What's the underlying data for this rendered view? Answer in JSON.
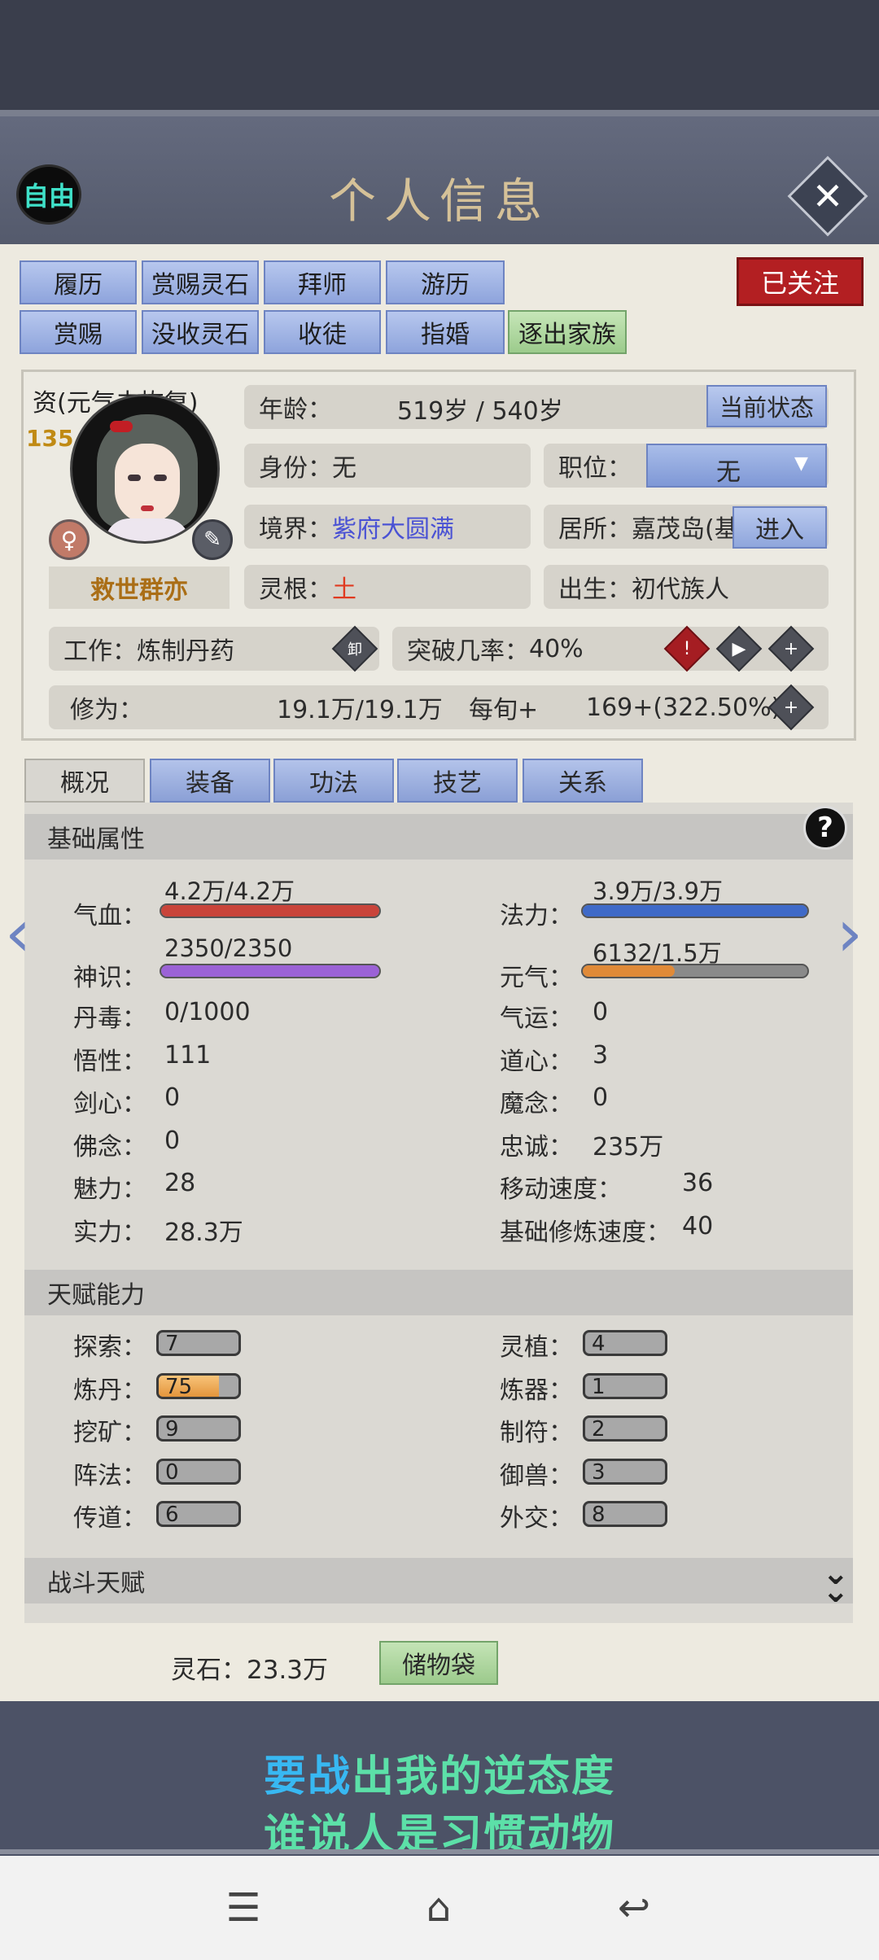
{
  "header": {
    "free_label": "自由",
    "title": "个人信息",
    "close_icon": "close-icon"
  },
  "actions": {
    "row1": [
      "履历",
      "赏赐灵石",
      "拜师",
      "游历"
    ],
    "row2": [
      "赏赐",
      "没收灵石",
      "收徒",
      "指婚",
      "逐出家族"
    ],
    "follow": "已关注"
  },
  "profile": {
    "aptitude_label": "资(元气未恢复)",
    "aptitude_value": "135",
    "name": "救世群亦",
    "gender_icon": "female-icon",
    "age_label": "年龄：",
    "age_value": "519岁 / 540岁",
    "state_button": "当前状态",
    "identity_label": "身份：",
    "identity_value": "无",
    "position_label": "职位：",
    "position_value": "无",
    "realm_label": "境界：",
    "realm_value": "紫府大圆满",
    "residence_label": "居所：嘉茂岛(基",
    "enter_button": "进入",
    "root_label": "灵根：",
    "root_value": "土",
    "birth_label": "出生：",
    "birth_value": "初代族人",
    "work_label": "工作：炼制丹药",
    "unload_label": "卸",
    "breakthrough_label": "突破几率：",
    "breakthrough_value": "40%",
    "cultivation_label": "修为：",
    "cultivation_value": "19.1万/19.1万",
    "per_round_label": "每旬+",
    "per_round_value": "169+(322.50%)"
  },
  "tabs": [
    "概况",
    "装备",
    "功法",
    "技艺",
    "关系"
  ],
  "sections": {
    "basic": "基础属性",
    "talent": "天赋能力",
    "combat": "战斗天赋"
  },
  "bars": {
    "hp": {
      "label": "气血：",
      "text": "4.2万/4.2万",
      "fraction": 1.0,
      "color": "#c9443a"
    },
    "mana": {
      "label": "法力：",
      "text": "3.9万/3.9万",
      "fraction": 1.0,
      "color": "#3f6ac8"
    },
    "spirit": {
      "label": "神识：",
      "text": "2350/2350",
      "fraction": 1.0,
      "color": "#9b62d6"
    },
    "vitality": {
      "label": "元气：",
      "text": "6132/1.5万",
      "fraction": 0.41,
      "color": "#e08a38"
    }
  },
  "stats_left": [
    {
      "label": "丹毒：",
      "value": "0/1000"
    },
    {
      "label": "悟性：",
      "value": "111"
    },
    {
      "label": "剑心：",
      "value": "0"
    },
    {
      "label": "佛念：",
      "value": "0"
    },
    {
      "label": "魅力：",
      "value": "28"
    },
    {
      "label": "实力：",
      "value": "28.3万"
    }
  ],
  "stats_right": [
    {
      "label": "气运：",
      "value": "0"
    },
    {
      "label": "道心：",
      "value": "3"
    },
    {
      "label": "魔念：",
      "value": "0"
    },
    {
      "label": "忠诚：",
      "value": "235万"
    },
    {
      "label": "移动速度：",
      "value": "36"
    },
    {
      "label": "基础修炼速度：",
      "value": "40"
    }
  ],
  "talents_left": [
    {
      "label": "探索：",
      "value": "7",
      "fraction": 0
    },
    {
      "label": "炼丹：",
      "value": "75",
      "fraction": 0.75
    },
    {
      "label": "挖矿：",
      "value": "9",
      "fraction": 0
    },
    {
      "label": "阵法：",
      "value": "0",
      "fraction": 0
    },
    {
      "label": "传道：",
      "value": "6",
      "fraction": 0
    }
  ],
  "talents_right": [
    {
      "label": "灵植：",
      "value": "4",
      "fraction": 0
    },
    {
      "label": "炼器：",
      "value": "1",
      "fraction": 0
    },
    {
      "label": "制符：",
      "value": "2",
      "fraction": 0
    },
    {
      "label": "御兽：",
      "value": "3",
      "fraction": 0
    },
    {
      "label": "外交：",
      "value": "8",
      "fraction": 0
    }
  ],
  "footer": {
    "stones": "灵石：23.3万",
    "bag_button": "储物袋"
  },
  "subtitles": {
    "line1_a": "要战",
    "line1_b": "出我的逆态度",
    "line2": "谁说人是习惯动物"
  }
}
